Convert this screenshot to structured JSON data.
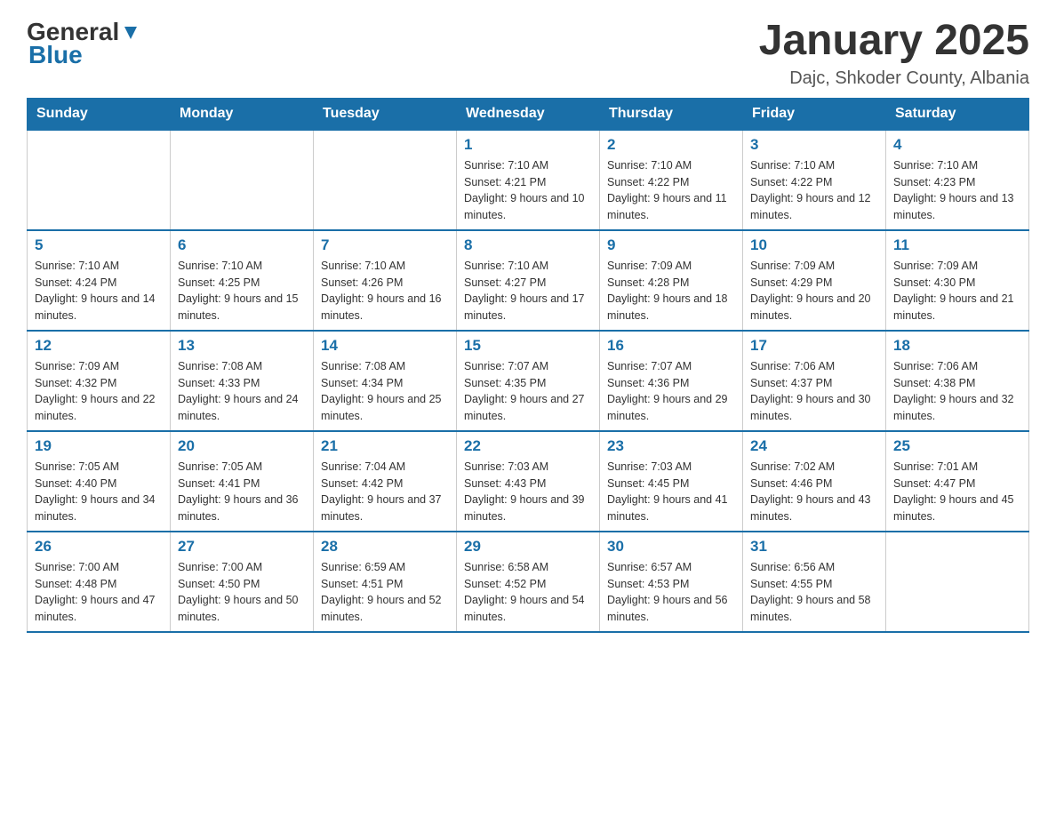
{
  "header": {
    "logo_general": "General",
    "logo_blue": "Blue",
    "month_title": "January 2025",
    "location": "Dajc, Shkoder County, Albania"
  },
  "calendar": {
    "days_of_week": [
      "Sunday",
      "Monday",
      "Tuesday",
      "Wednesday",
      "Thursday",
      "Friday",
      "Saturday"
    ],
    "weeks": [
      [
        {
          "day": "",
          "sunrise": "",
          "sunset": "",
          "daylight": ""
        },
        {
          "day": "",
          "sunrise": "",
          "sunset": "",
          "daylight": ""
        },
        {
          "day": "",
          "sunrise": "",
          "sunset": "",
          "daylight": ""
        },
        {
          "day": "1",
          "sunrise": "Sunrise: 7:10 AM",
          "sunset": "Sunset: 4:21 PM",
          "daylight": "Daylight: 9 hours and 10 minutes."
        },
        {
          "day": "2",
          "sunrise": "Sunrise: 7:10 AM",
          "sunset": "Sunset: 4:22 PM",
          "daylight": "Daylight: 9 hours and 11 minutes."
        },
        {
          "day": "3",
          "sunrise": "Sunrise: 7:10 AM",
          "sunset": "Sunset: 4:22 PM",
          "daylight": "Daylight: 9 hours and 12 minutes."
        },
        {
          "day": "4",
          "sunrise": "Sunrise: 7:10 AM",
          "sunset": "Sunset: 4:23 PM",
          "daylight": "Daylight: 9 hours and 13 minutes."
        }
      ],
      [
        {
          "day": "5",
          "sunrise": "Sunrise: 7:10 AM",
          "sunset": "Sunset: 4:24 PM",
          "daylight": "Daylight: 9 hours and 14 minutes."
        },
        {
          "day": "6",
          "sunrise": "Sunrise: 7:10 AM",
          "sunset": "Sunset: 4:25 PM",
          "daylight": "Daylight: 9 hours and 15 minutes."
        },
        {
          "day": "7",
          "sunrise": "Sunrise: 7:10 AM",
          "sunset": "Sunset: 4:26 PM",
          "daylight": "Daylight: 9 hours and 16 minutes."
        },
        {
          "day": "8",
          "sunrise": "Sunrise: 7:10 AM",
          "sunset": "Sunset: 4:27 PM",
          "daylight": "Daylight: 9 hours and 17 minutes."
        },
        {
          "day": "9",
          "sunrise": "Sunrise: 7:09 AM",
          "sunset": "Sunset: 4:28 PM",
          "daylight": "Daylight: 9 hours and 18 minutes."
        },
        {
          "day": "10",
          "sunrise": "Sunrise: 7:09 AM",
          "sunset": "Sunset: 4:29 PM",
          "daylight": "Daylight: 9 hours and 20 minutes."
        },
        {
          "day": "11",
          "sunrise": "Sunrise: 7:09 AM",
          "sunset": "Sunset: 4:30 PM",
          "daylight": "Daylight: 9 hours and 21 minutes."
        }
      ],
      [
        {
          "day": "12",
          "sunrise": "Sunrise: 7:09 AM",
          "sunset": "Sunset: 4:32 PM",
          "daylight": "Daylight: 9 hours and 22 minutes."
        },
        {
          "day": "13",
          "sunrise": "Sunrise: 7:08 AM",
          "sunset": "Sunset: 4:33 PM",
          "daylight": "Daylight: 9 hours and 24 minutes."
        },
        {
          "day": "14",
          "sunrise": "Sunrise: 7:08 AM",
          "sunset": "Sunset: 4:34 PM",
          "daylight": "Daylight: 9 hours and 25 minutes."
        },
        {
          "day": "15",
          "sunrise": "Sunrise: 7:07 AM",
          "sunset": "Sunset: 4:35 PM",
          "daylight": "Daylight: 9 hours and 27 minutes."
        },
        {
          "day": "16",
          "sunrise": "Sunrise: 7:07 AM",
          "sunset": "Sunset: 4:36 PM",
          "daylight": "Daylight: 9 hours and 29 minutes."
        },
        {
          "day": "17",
          "sunrise": "Sunrise: 7:06 AM",
          "sunset": "Sunset: 4:37 PM",
          "daylight": "Daylight: 9 hours and 30 minutes."
        },
        {
          "day": "18",
          "sunrise": "Sunrise: 7:06 AM",
          "sunset": "Sunset: 4:38 PM",
          "daylight": "Daylight: 9 hours and 32 minutes."
        }
      ],
      [
        {
          "day": "19",
          "sunrise": "Sunrise: 7:05 AM",
          "sunset": "Sunset: 4:40 PM",
          "daylight": "Daylight: 9 hours and 34 minutes."
        },
        {
          "day": "20",
          "sunrise": "Sunrise: 7:05 AM",
          "sunset": "Sunset: 4:41 PM",
          "daylight": "Daylight: 9 hours and 36 minutes."
        },
        {
          "day": "21",
          "sunrise": "Sunrise: 7:04 AM",
          "sunset": "Sunset: 4:42 PM",
          "daylight": "Daylight: 9 hours and 37 minutes."
        },
        {
          "day": "22",
          "sunrise": "Sunrise: 7:03 AM",
          "sunset": "Sunset: 4:43 PM",
          "daylight": "Daylight: 9 hours and 39 minutes."
        },
        {
          "day": "23",
          "sunrise": "Sunrise: 7:03 AM",
          "sunset": "Sunset: 4:45 PM",
          "daylight": "Daylight: 9 hours and 41 minutes."
        },
        {
          "day": "24",
          "sunrise": "Sunrise: 7:02 AM",
          "sunset": "Sunset: 4:46 PM",
          "daylight": "Daylight: 9 hours and 43 minutes."
        },
        {
          "day": "25",
          "sunrise": "Sunrise: 7:01 AM",
          "sunset": "Sunset: 4:47 PM",
          "daylight": "Daylight: 9 hours and 45 minutes."
        }
      ],
      [
        {
          "day": "26",
          "sunrise": "Sunrise: 7:00 AM",
          "sunset": "Sunset: 4:48 PM",
          "daylight": "Daylight: 9 hours and 47 minutes."
        },
        {
          "day": "27",
          "sunrise": "Sunrise: 7:00 AM",
          "sunset": "Sunset: 4:50 PM",
          "daylight": "Daylight: 9 hours and 50 minutes."
        },
        {
          "day": "28",
          "sunrise": "Sunrise: 6:59 AM",
          "sunset": "Sunset: 4:51 PM",
          "daylight": "Daylight: 9 hours and 52 minutes."
        },
        {
          "day": "29",
          "sunrise": "Sunrise: 6:58 AM",
          "sunset": "Sunset: 4:52 PM",
          "daylight": "Daylight: 9 hours and 54 minutes."
        },
        {
          "day": "30",
          "sunrise": "Sunrise: 6:57 AM",
          "sunset": "Sunset: 4:53 PM",
          "daylight": "Daylight: 9 hours and 56 minutes."
        },
        {
          "day": "31",
          "sunrise": "Sunrise: 6:56 AM",
          "sunset": "Sunset: 4:55 PM",
          "daylight": "Daylight: 9 hours and 58 minutes."
        },
        {
          "day": "",
          "sunrise": "",
          "sunset": "",
          "daylight": ""
        }
      ]
    ]
  }
}
